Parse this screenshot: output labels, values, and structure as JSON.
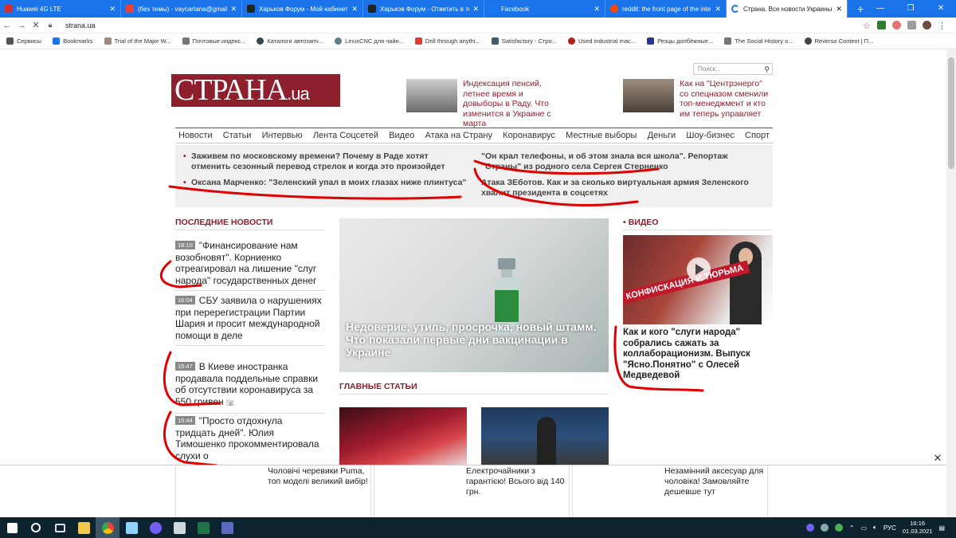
{
  "browser": {
    "tabs": [
      {
        "title": "Huawei 4G LTE",
        "color": "#d32f2f"
      },
      {
        "title": "(без темы) - vaycartana@gmail.c",
        "color": "#ea4335"
      },
      {
        "title": "Харьков Форум - Мой кабинет",
        "color": "#222222"
      },
      {
        "title": "Харьков Форум - Ответить в те",
        "color": "#222222"
      },
      {
        "title": "Facebook",
        "color": "#1877f2"
      },
      {
        "title": "reddit: the front page of the inte",
        "color": "#ff4500"
      },
      {
        "title": "Страна. Все новости Украины. Б",
        "color": "#1a73e8",
        "active": true
      }
    ],
    "url": "strana.ua",
    "bookmarks": [
      "Сервисы",
      "Bookmarks",
      "Trial of the Major W...",
      "Почтовые индекс...",
      "Каталоги автозапч...",
      "LinuxCNC для чайн...",
      "Drill through anythi...",
      "Satisfactory - Стро...",
      "Used industrial mac...",
      "Резцы долбёжные...",
      "The Social History o...",
      "Reverso Context | П..."
    ]
  },
  "site": {
    "logo_main": "СТРАНА",
    "logo_suffix": ".ua",
    "search_placeholder": "Поиск...",
    "promos": [
      "Индексация пенсий, летнее время и довыборы в Раду. Что изменится в Украине с марта",
      "Как на \"Центрэнерго\" со спецназом сменили топ-менеджмент и кто им теперь управляет"
    ],
    "menu": [
      "Новости",
      "Статьи",
      "Интервью",
      "Лента Соцсетей",
      "Видео",
      "Атака на Страну",
      "Коронавирус",
      "Местные выборы",
      "Деньги",
      "Шоу-бизнес",
      "Спорт"
    ],
    "headlines": [
      "Заживем по московскому времени? Почему в Раде хотят отменить сезонный перевод стрелок и когда это произойдет",
      "Оксана Марченко: \"Зеленский упал в моих глазах ниже плинтуса\"",
      "\"Он крал телефоны, и об этом знала вся школа\". Репортаж \"Страны\" из родного села Сергея Стерненко",
      "Атака ЗЕботов. Как и за сколько виртуальная армия Зеленского хвалит президента в соцсетях"
    ],
    "latest_title": "ПОСЛЕДНИЕ НОВОСТИ",
    "latest": [
      {
        "time": "16:10",
        "text": "\"Финансирование нам возобновят\". Корниенко отреагировал на лишение \"слуг народа\" государственных денег"
      },
      {
        "time": "16:04",
        "text": "СБУ заявила о нарушениях при перерегистрации Партии Шария и просит международной помощи в деле"
      },
      {
        "time": "15:47",
        "text": "В Киеве иностранка продавала поддельные справки об отсутствии коронавируса за 550 гривен"
      },
      {
        "time": "15:44",
        "text": "\"Просто отдохнула тридцать дней\". Юлия Тимошенко прокомментировала слухи о"
      }
    ],
    "main_caption": "Недоверие, утиль, просрочка, новый штамм. Что показали первые дни вакцинации в Украине",
    "main_articles_title": "ГЛАВНЫЕ СТАТЬИ",
    "video_title": "ВИДЕО",
    "video_banner": "КОНФИСКАЦИЯ И ТЮРЬМА",
    "video_caption": "Как и кого \"слуги народа\" собрались сажать за коллаборационизм. Выпуск \"Ясно.Понятно\" с Олесей Медведевой",
    "ads": [
      "Чоловічі черевики Puma, топ моделі великий вибір!",
      "Електрочайники з гарантією! Всього від 140 грн.",
      "Незамінний аксесуар для чоловіка! Замовляйте дешевше тут"
    ]
  },
  "taskbar": {
    "lang": "РУС",
    "time": "16:16",
    "date": "01.03.2021"
  },
  "colors": {
    "brand": "#8e1f2c",
    "tabbar": "#1a73e8",
    "taskbar": "#0d2430"
  }
}
